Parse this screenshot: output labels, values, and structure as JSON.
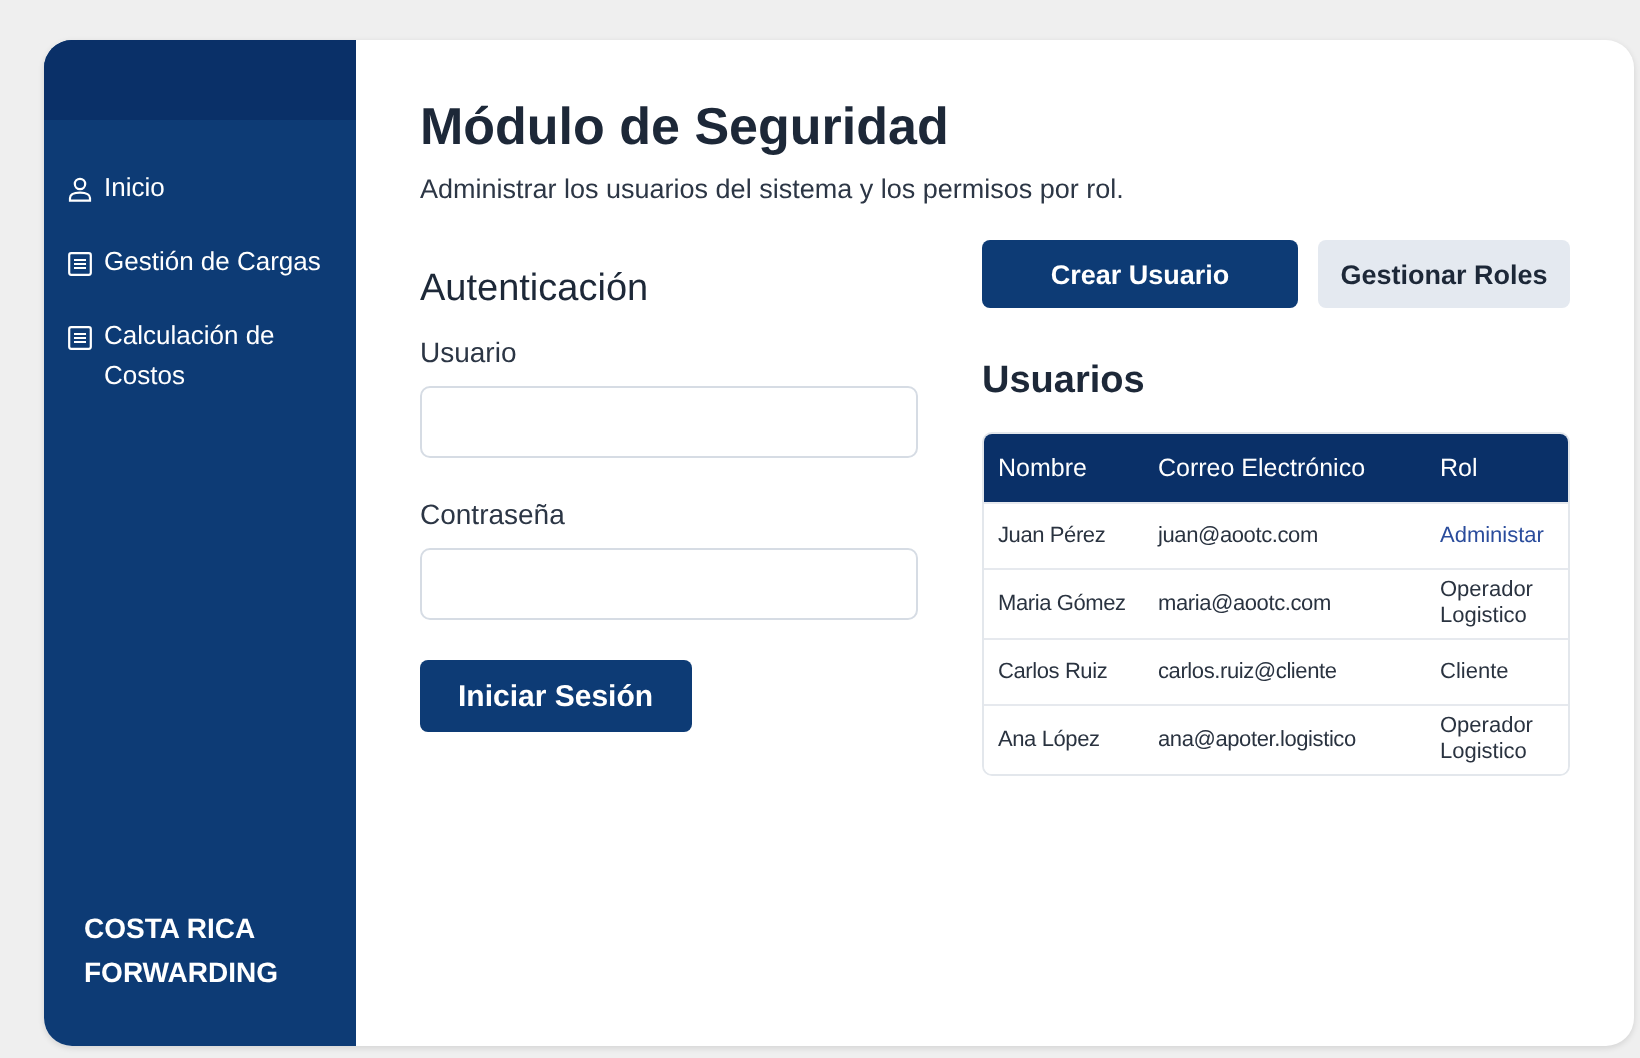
{
  "sidebar": {
    "items": [
      {
        "label": "Inicio",
        "kind": "user"
      },
      {
        "label": "Gestión de Cargas",
        "kind": "doc"
      },
      {
        "label": "Calculación de Costos",
        "kind": "doc"
      }
    ],
    "brand": "COSTA RICA FORWARDING"
  },
  "header": {
    "title": "Módulo de Seguridad",
    "subtitle": "Administrar los usuarios del sistema y los permisos por rol."
  },
  "login": {
    "title": "Autenticación",
    "fields": [
      {
        "label": "Usuario"
      },
      {
        "label": "Contraseña"
      }
    ],
    "button": "Iniciar Sesión"
  },
  "actions": [
    {
      "label": "Crear Usuario",
      "kind": "primary"
    },
    {
      "label": "Gestionar Roles",
      "kind": "secondary"
    }
  ],
  "users": {
    "title": "Usuarios",
    "columns": [
      "Nombre",
      "Correo Electrónico",
      "Rol"
    ],
    "rows": [
      {
        "name": "Juan Pérez",
        "email": "juan@aootc.com",
        "role": "Administar",
        "role_highlighted": true
      },
      {
        "name": "Maria Gómez",
        "email": "maria@aootc.com",
        "role": "Operador Logistico",
        "role_highlighted": false
      },
      {
        "name": "Carlos Ruiz",
        "email": "carlos.ruiz@cliente",
        "role": "Cliente",
        "role_highlighted": false
      },
      {
        "name": "Ana López",
        "email": "ana@apoter.logistico",
        "role": "Operador Logistico",
        "role_highlighted": false
      }
    ]
  }
}
